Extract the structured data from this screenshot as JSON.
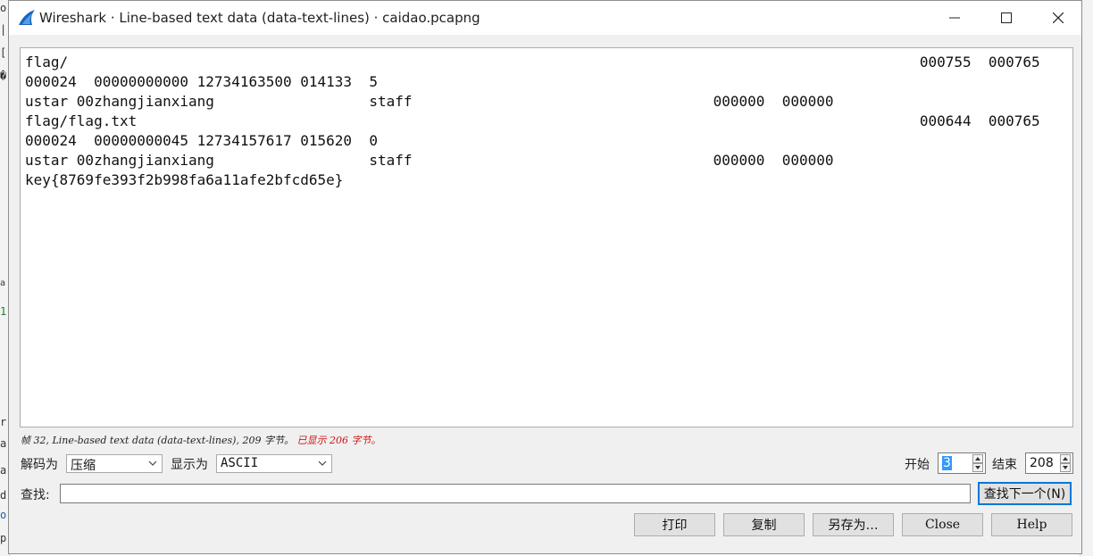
{
  "window": {
    "title": "Wireshark · Line-based text data (data-text-lines) · caidao.pcapng"
  },
  "content_lines": [
    "flag/                                                                                                   000755  000765",
    "000024  00000000000 12734163500 014133  5",
    "ustar 00zhangjianxiang                  staff                                   000000  000000",
    "flag/flag.txt                                                                                           000644  000765",
    "000024  00000000045 12734157617 015620  0",
    "ustar 00zhangjianxiang                  staff                                   000000  000000",
    "key{8769fe393f2b998fa6a11afe2bfcd65e}"
  ],
  "status": {
    "main": "帧 32, Line-based text data (data-text-lines), 209 字节。",
    "shown": "已显示 206 字节。"
  },
  "decode": {
    "label": "解码为",
    "value": "压缩"
  },
  "display": {
    "label": "显示为",
    "value": "ASCII"
  },
  "range": {
    "start_label": "开始",
    "start_value": "3",
    "end_label": "结束",
    "end_value": "208"
  },
  "find": {
    "label": "查找:",
    "value": "",
    "next_label": "查找下一个(N)"
  },
  "buttons": {
    "print": "打印",
    "copy": "复制",
    "save_as": "另存为…",
    "close": "Close",
    "help": "Help"
  }
}
